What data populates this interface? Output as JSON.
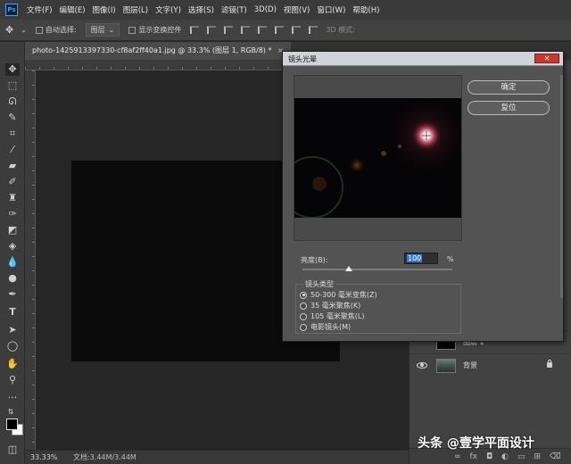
{
  "app": {
    "logo_text": "Ps"
  },
  "menu": [
    "文件(F)",
    "编辑(E)",
    "图像(I)",
    "图层(L)",
    "文字(Y)",
    "选择(S)",
    "滤镜(T)",
    "3D(D)",
    "视图(V)",
    "窗口(W)",
    "帮助(H)"
  ],
  "options_bar": {
    "auto_select_label": "自动选择:",
    "auto_select_target": "图层",
    "show_transform_label": "显示变换控件",
    "mode_3d_label": "3D 模式:"
  },
  "document_tab": {
    "title": "photo-1425913397330-cf8af2ff40a1.jpg @ 33.3% (图层 1, RGB/8) *",
    "close_glyph": "×"
  },
  "status_bar": {
    "zoom": "33.33%",
    "doc_size": "文档:3.44M/3.44M"
  },
  "layers": [
    {
      "name": "图层 1",
      "visible": false,
      "locked": false
    },
    {
      "name": "背景",
      "visible": true,
      "locked": true
    }
  ],
  "dialog": {
    "title": "镜头光晕",
    "close_glyph": "✕",
    "ok_label": "确定",
    "reset_label": "复位",
    "brightness_label": "亮度(B):",
    "brightness_value": "100",
    "brightness_unit": "%",
    "brightness_slider": {
      "value": 100,
      "min": 10,
      "max": 300
    },
    "lens_type_title": "镜头类型",
    "lens_types": [
      {
        "label": "50-300 毫米变焦(Z)",
        "checked": true
      },
      {
        "label": "35 毫米聚焦(K)",
        "checked": false
      },
      {
        "label": "105 毫米聚焦(L)",
        "checked": false
      },
      {
        "label": "电影镜头(M)",
        "checked": false
      }
    ]
  },
  "watermark": "头条 @壹学平面设计",
  "tools": [
    "move-icon",
    "marquee-icon",
    "lasso-icon",
    "quick-select-icon",
    "crop-icon",
    "eyedropper-icon",
    "healing-brush-icon",
    "brush-icon",
    "clone-stamp-icon",
    "history-brush-icon",
    "eraser-icon",
    "paint-bucket-icon",
    "blur-icon",
    "dodge-icon",
    "pen-icon",
    "type-icon",
    "path-select-icon",
    "ellipse-icon",
    "hand-icon",
    "zoom-icon",
    "more-tools-icon"
  ],
  "colors": {
    "foreground": "#000000",
    "background": "#ffffff",
    "ps_accent": "#31a8ff",
    "dialog_close": "#c8392b"
  }
}
